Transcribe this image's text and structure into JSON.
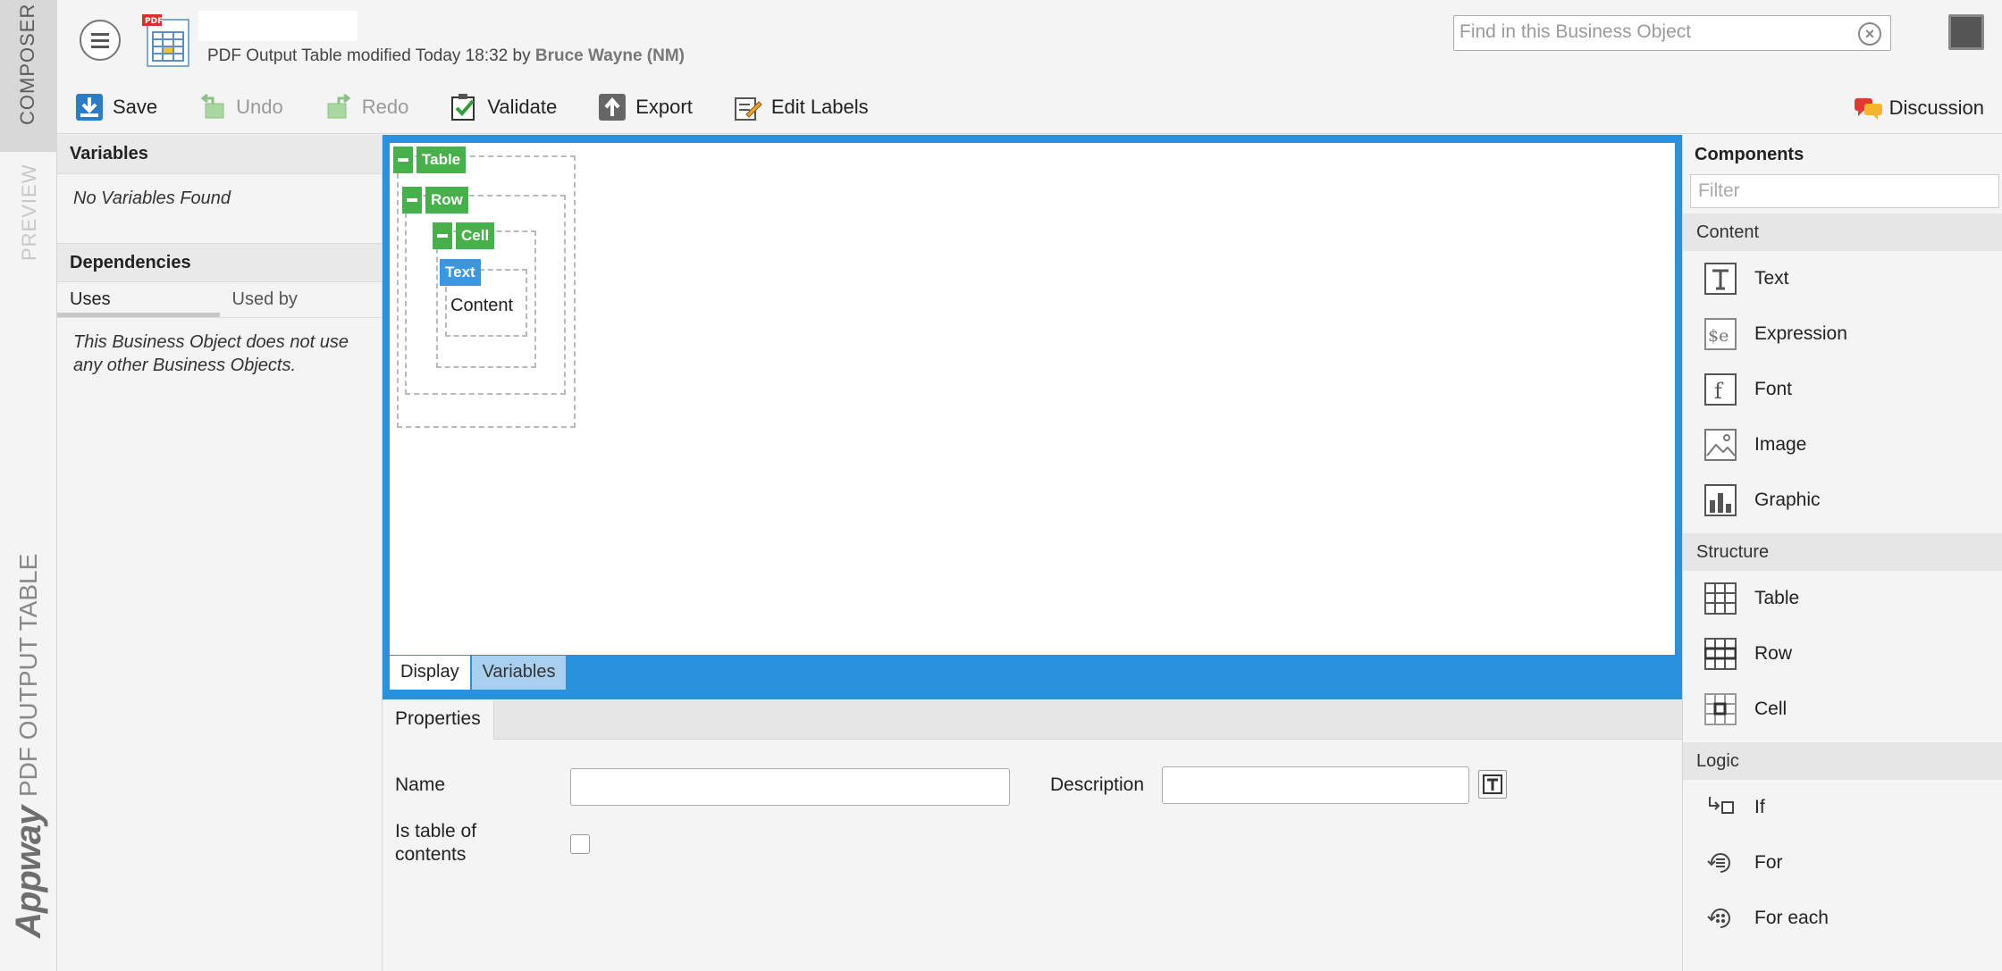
{
  "sidebar": {
    "composer_label": "COMPOSER",
    "preview_label": "PREVIEW",
    "object_label": "PDF OUTPUT TABLE",
    "brand": "Appway"
  },
  "header": {
    "subtitle_prefix": "PDF Output Table modified Today 18:32 by",
    "subtitle_user": "Bruce Wayne (NM)",
    "search_placeholder": "Find in this Business Object",
    "search_value": ""
  },
  "toolbar": {
    "save": "Save",
    "undo": "Undo",
    "redo": "Redo",
    "validate": "Validate",
    "export": "Export",
    "edit_labels": "Edit Labels",
    "discussion": "Discussion"
  },
  "left_panel": {
    "variables_title": "Variables",
    "variables_empty": "No Variables Found",
    "dependencies_title": "Dependencies",
    "tab_uses": "Uses",
    "tab_used_by": "Used by",
    "uses_message": "This Business Object does not use any other Business Objects."
  },
  "canvas": {
    "table_tag": "Table",
    "row_tag": "Row",
    "cell_tag": "Cell",
    "text_tag": "Text",
    "content": "Content",
    "tab_display": "Display",
    "tab_variables": "Variables"
  },
  "properties": {
    "tab": "Properties",
    "name_label": "Name",
    "name_value": "",
    "description_label": "Description",
    "description_value": "",
    "toc_label_line1": "Is table of",
    "toc_label_line2": "contents",
    "toc_checked": false
  },
  "components": {
    "title": "Components",
    "filter_placeholder": "Filter",
    "sections": [
      {
        "title": "Content",
        "items": [
          {
            "label": "Text",
            "icon": "text-icon"
          },
          {
            "label": "Expression",
            "icon": "expression-icon"
          },
          {
            "label": "Font",
            "icon": "font-icon"
          },
          {
            "label": "Image",
            "icon": "image-icon"
          },
          {
            "label": "Graphic",
            "icon": "graphic-icon"
          }
        ]
      },
      {
        "title": "Structure",
        "items": [
          {
            "label": "Table",
            "icon": "table-icon"
          },
          {
            "label": "Row",
            "icon": "row-icon"
          },
          {
            "label": "Cell",
            "icon": "cell-icon"
          }
        ]
      },
      {
        "title": "Logic",
        "items": [
          {
            "label": "If",
            "icon": "if-icon"
          },
          {
            "label": "For",
            "icon": "for-icon"
          },
          {
            "label": "For each",
            "icon": "for-each-icon"
          }
        ]
      }
    ]
  },
  "colors": {
    "accent_blue": "#2a92dc",
    "tag_green": "#46b04a",
    "tag_blue": "#3a98e0"
  }
}
